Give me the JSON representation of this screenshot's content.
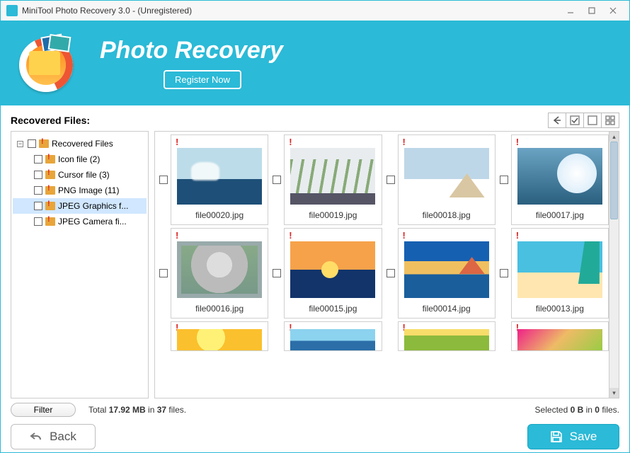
{
  "window": {
    "title": "MiniTool Photo Recovery 3.0 - (Unregistered)"
  },
  "banner": {
    "title": "Photo Recovery",
    "register_label": "Register Now"
  },
  "section": {
    "recovered_label": "Recovered Files:"
  },
  "tree": {
    "root": "Recovered Files",
    "items": [
      {
        "label": "Icon file (2)"
      },
      {
        "label": "Cursor file (3)"
      },
      {
        "label": "PNG Image (11)"
      },
      {
        "label": "JPEG Graphics f..."
      },
      {
        "label": "JPEG Camera fi..."
      }
    ],
    "selected_index": 3
  },
  "thumbs": [
    {
      "name": "file00020.jpg",
      "art": "t1"
    },
    {
      "name": "file00019.jpg",
      "art": "t2"
    },
    {
      "name": "file00018.jpg",
      "art": "t3"
    },
    {
      "name": "file00017.jpg",
      "art": "t4"
    },
    {
      "name": "file00016.jpg",
      "art": "t5"
    },
    {
      "name": "file00015.jpg",
      "art": "t6"
    },
    {
      "name": "file00014.jpg",
      "art": "t7"
    },
    {
      "name": "file00013.jpg",
      "art": "t8"
    },
    {
      "name": "",
      "art": "t9"
    },
    {
      "name": "",
      "art": "t10"
    },
    {
      "name": "",
      "art": "t11"
    },
    {
      "name": "",
      "art": "t12"
    }
  ],
  "footer": {
    "filter_label": "Filter",
    "total_prefix": "Total ",
    "total_size": "17.92 MB",
    "total_mid": " in ",
    "total_count": "37",
    "total_suffix": " files.",
    "selected_prefix": "Selected ",
    "selected_size": "0 B",
    "selected_mid": " in ",
    "selected_count": "0",
    "selected_suffix": " files.",
    "back_label": "Back",
    "save_label": "Save"
  }
}
